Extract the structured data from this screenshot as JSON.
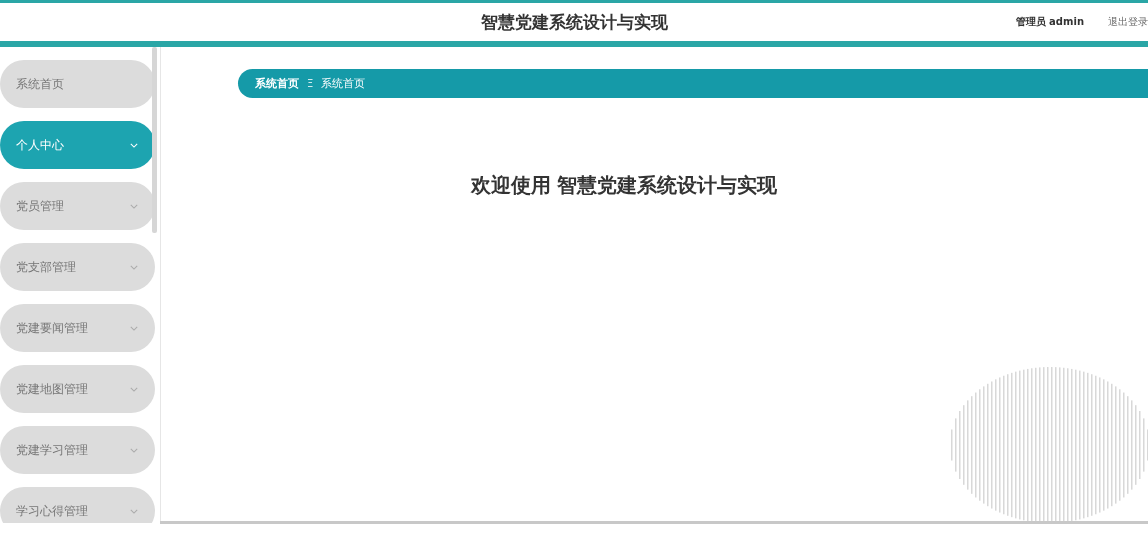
{
  "header": {
    "title": "智慧党建系统设计与实现",
    "user": "管理员 admin",
    "logout": "退出登录"
  },
  "sidebar": {
    "items": [
      {
        "label": "系统首页",
        "selected": false,
        "expandable": false
      },
      {
        "label": "个人中心",
        "selected": true,
        "expandable": true
      },
      {
        "label": "党员管理",
        "selected": false,
        "expandable": true
      },
      {
        "label": "党支部管理",
        "selected": false,
        "expandable": true
      },
      {
        "label": "党建要闻管理",
        "selected": false,
        "expandable": true
      },
      {
        "label": "党建地图管理",
        "selected": false,
        "expandable": true
      },
      {
        "label": "党建学习管理",
        "selected": false,
        "expandable": true
      },
      {
        "label": "学习心得管理",
        "selected": false,
        "expandable": true
      }
    ]
  },
  "breadcrumb": {
    "items": [
      "系统首页",
      "系统首页"
    ],
    "separator": "Ξ"
  },
  "welcome": "欢迎使用 智慧党建系统设计与实现"
}
